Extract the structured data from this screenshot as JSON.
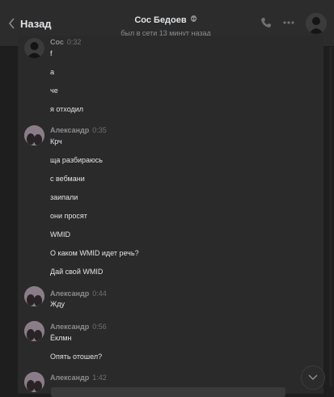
{
  "header": {
    "back_label": "Назад",
    "contact_name": "Сос Бедоев",
    "status": "был в сети 13 минут назад"
  },
  "icons": {
    "back": "chevron-left-icon",
    "verified": "alien-icon",
    "call": "phone-icon",
    "more": "more-icon",
    "scroll": "chevron-down-icon"
  },
  "colors": {
    "background": "#1e1e1e",
    "panel": "#2a2a2a",
    "header": "#2c2c2c",
    "text": "#e1e3e6",
    "muted": "#8a8c8f"
  },
  "messages": [
    {
      "author": "Сос",
      "time": "0:32",
      "lines": [
        "f",
        "а",
        "че",
        "я отходил"
      ]
    },
    {
      "author": "Александр",
      "time": "0:35",
      "lines": [
        "Крч",
        "ща разбираюсь",
        "с вебмани",
        "заипали",
        "они просят",
        "WMID",
        "О каком WMID идет речь?",
        "Дай свой WMID"
      ]
    },
    {
      "author": "Александр",
      "time": "0:44",
      "lines": [
        "Жду"
      ]
    },
    {
      "author": "Александр",
      "time": "0:56",
      "lines": [
        "Ёклмн",
        "Опять отошел?"
      ]
    },
    {
      "author": "Александр",
      "time": "1:42",
      "lines": []
    }
  ]
}
